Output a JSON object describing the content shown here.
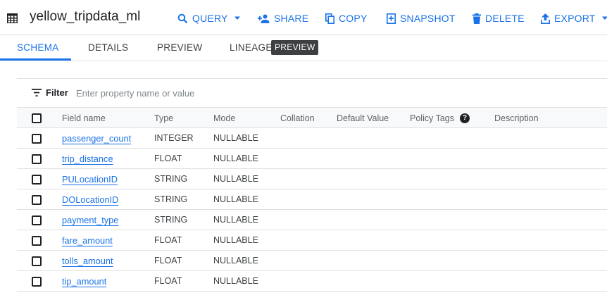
{
  "header": {
    "title": "yellow_tripdata_ml",
    "actions": {
      "query": "QUERY",
      "share": "SHARE",
      "copy": "COPY",
      "snapshot": "SNAPSHOT",
      "delete": "DELETE",
      "export": "EXPORT"
    },
    "accent_color": "#1a73e8"
  },
  "tabs": {
    "schema": "SCHEMA",
    "details": "DETAILS",
    "preview": "PREVIEW",
    "lineage": "LINEAGE",
    "lineage_badge": "PREVIEW",
    "active": "SCHEMA"
  },
  "filter": {
    "label": "Filter",
    "placeholder": "Enter property name or value"
  },
  "table": {
    "columns": {
      "field_name": "Field name",
      "type": "Type",
      "mode": "Mode",
      "collation": "Collation",
      "default_value": "Default Value",
      "policy_tags": "Policy Tags",
      "description": "Description"
    },
    "rows": [
      {
        "name": "passenger_count",
        "type": "INTEGER",
        "mode": "NULLABLE"
      },
      {
        "name": "trip_distance",
        "type": "FLOAT",
        "mode": "NULLABLE"
      },
      {
        "name": "PULocationID",
        "type": "STRING",
        "mode": "NULLABLE"
      },
      {
        "name": "DOLocationID",
        "type": "STRING",
        "mode": "NULLABLE"
      },
      {
        "name": "payment_type",
        "type": "STRING",
        "mode": "NULLABLE"
      },
      {
        "name": "fare_amount",
        "type": "FLOAT",
        "mode": "NULLABLE"
      },
      {
        "name": "tolls_amount",
        "type": "FLOAT",
        "mode": "NULLABLE"
      },
      {
        "name": "tip_amount",
        "type": "FLOAT",
        "mode": "NULLABLE"
      }
    ]
  }
}
